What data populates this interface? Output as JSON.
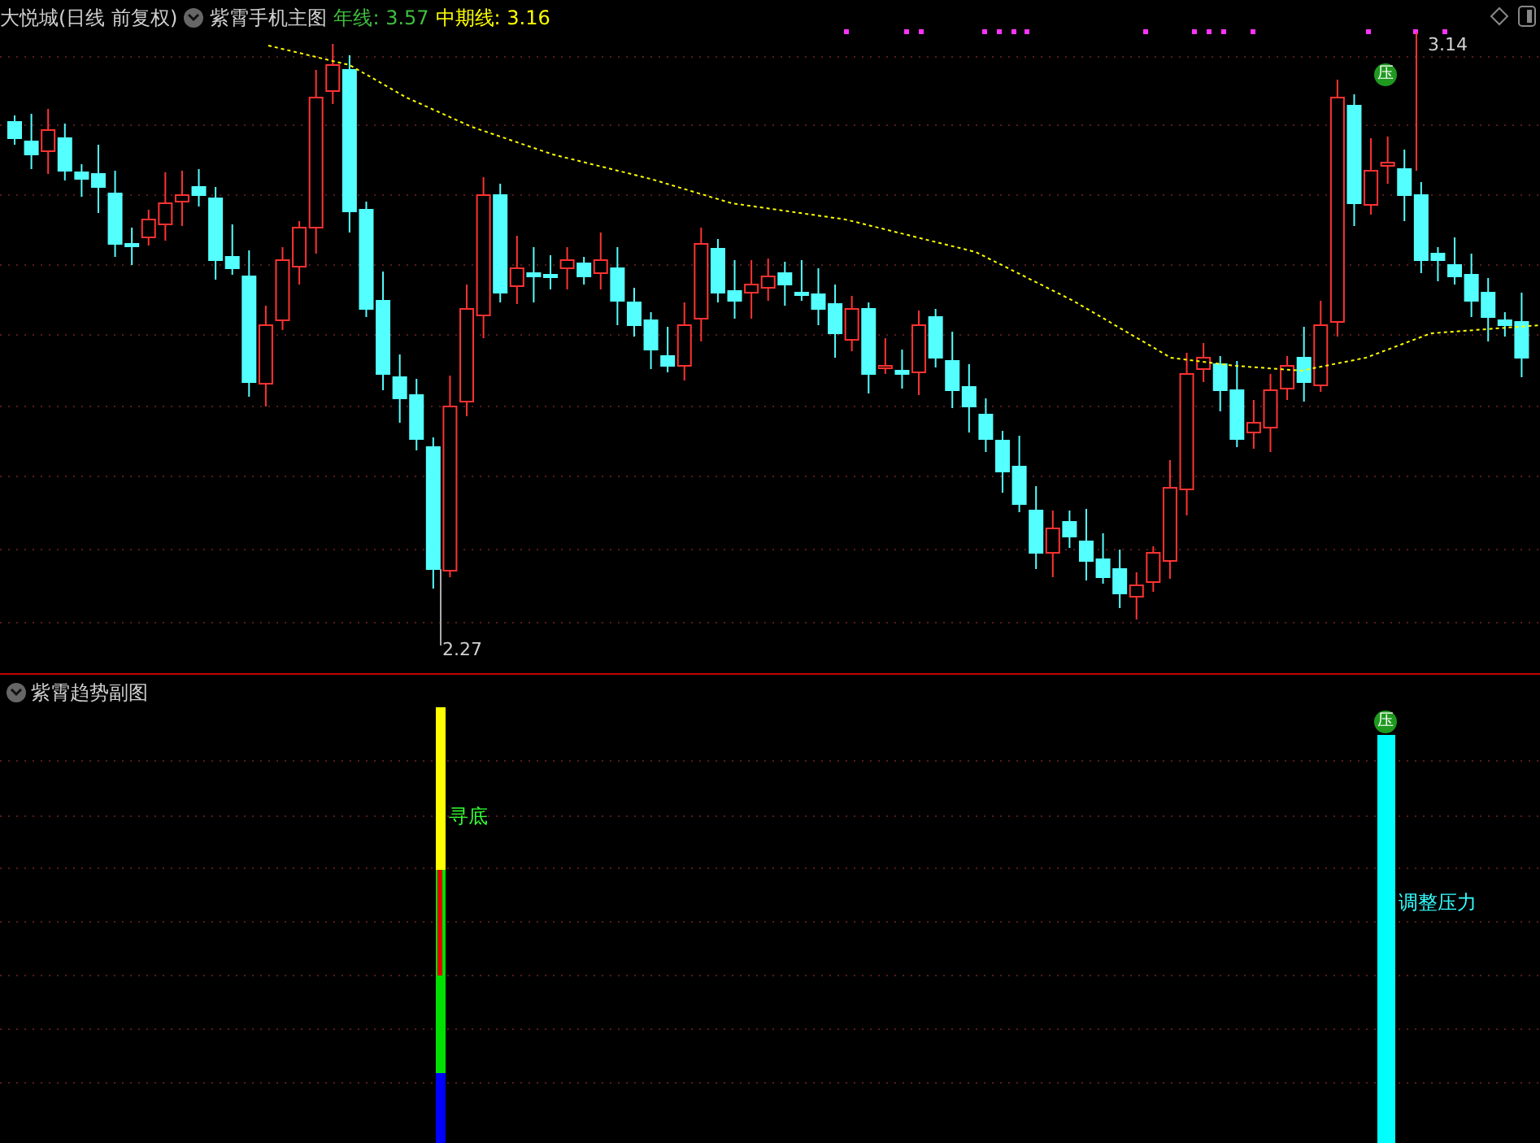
{
  "main_panel": {
    "stock_title": "大悦城(日线 前复权)",
    "indicator_name": "紫霄手机主图",
    "legend": [
      {
        "label": "年线:",
        "value": "3.57",
        "color": "#3fbf3f"
      },
      {
        "label": "中期线:",
        "value": "3.16",
        "color": "#ffff00"
      }
    ],
    "high_label": "3.14",
    "low_label": "2.27",
    "marker": "压"
  },
  "sub_panel": {
    "title": "紫霄趋势副图",
    "marker": "压",
    "bottom_label": "寻底",
    "pressure_label": "调整压力"
  }
}
